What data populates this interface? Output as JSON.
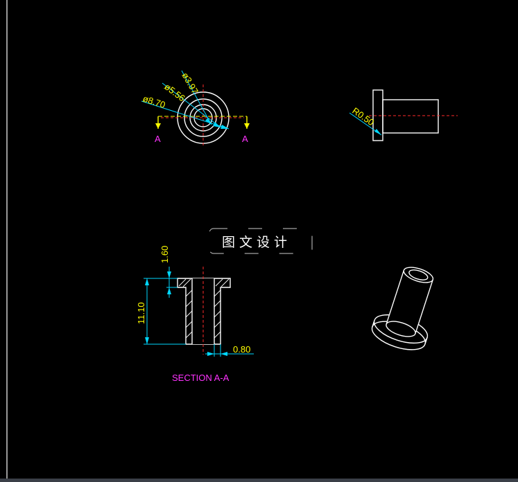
{
  "drawing": {
    "front_view": {
      "dim_outer": "ø8.70",
      "dim_mid": "ø5.56",
      "dim_inner": "ø3.97",
      "cut_label_left": "A",
      "cut_label_right": "A"
    },
    "side_view": {
      "dim_radius": "R0.50"
    },
    "section_view": {
      "dim_flange": "1.60",
      "dim_height": "11.10",
      "dim_wall": "0.80",
      "title": "SECTION  A-A"
    },
    "watermark": {
      "text": "图文设计"
    }
  },
  "colors": {
    "background": "#000000",
    "geometry": "#ffffff",
    "dimension_line": "#00d7ff",
    "dimension_text": "#ffff00",
    "center_line": "#ff2a2a",
    "label": "#ff33ff"
  }
}
